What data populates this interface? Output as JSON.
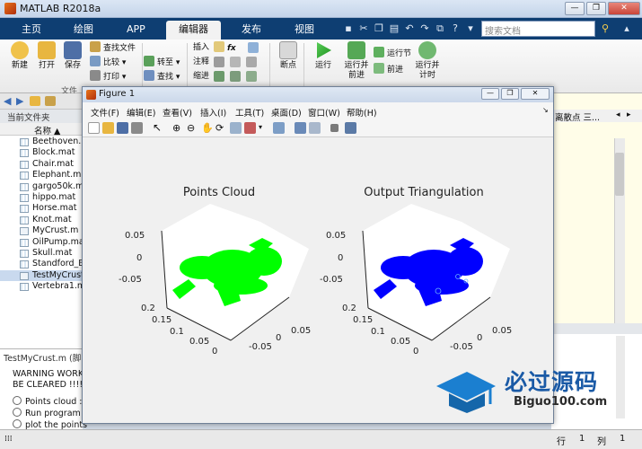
{
  "app": {
    "title": "MATLAB R2018a"
  },
  "tabs": [
    "主页",
    "绘图",
    "APP",
    "编辑器",
    "发布",
    "视图"
  ],
  "active_tab": "编辑器",
  "search": {
    "placeholder": "搜索文档"
  },
  "ribbon": {
    "big_buttons": [
      "新建",
      "打开",
      "保存",
      "断点",
      "运行",
      "运行并前进",
      "运行节",
      "前进",
      "运行并计时"
    ],
    "find_files": "查找文件",
    "compare": "比较",
    "print": "打印",
    "insert": "插入",
    "comment": "注释",
    "indent": "缩进",
    "goto": "转至",
    "find": "查找",
    "fx": "fx",
    "group_file": "文件",
    "run_and_advance": "运行并前进",
    "run_section": "运行节",
    "advance": "前进",
    "run_and_time": "运行并计时"
  },
  "path_right": "matlab",
  "right_panel_header": "离散点 三...",
  "left_panel": {
    "title": "当前文件夹",
    "column_name": "名称 ▲",
    "files": [
      "Beethoven.mat",
      "Block.mat",
      "Chair.mat",
      "Elephant.mat",
      "gargo50k.mat",
      "hippo.mat",
      "Horse.mat",
      "Knot.mat",
      "MyCrust.m",
      "OilPump.mat",
      "Skull.mat",
      "Standford_Bu",
      "TestMyCrust.m",
      "Vertebra1.mat"
    ],
    "selected": "TestMyCrust.m",
    "details_title": "TestMyCrust.m (脚",
    "details_lines": [
      "WARNING WORK",
      "BE CLEARED !!!!!",
      "Points cloud :",
      "Run  program",
      "plot the points"
    ]
  },
  "figure": {
    "title": "Figure 1",
    "menus": [
      "文件(F)",
      "编辑(E)",
      "查看(V)",
      "插入(I)",
      "工具(T)",
      "桌面(D)",
      "窗口(W)",
      "帮助(H)"
    ],
    "left_title": "Points Cloud",
    "right_title": "Output Triangulation",
    "left_color": "#00ff00",
    "right_color": "#0000ff",
    "z_ticks": [
      "0.05",
      "0",
      "-0.05"
    ],
    "y_ticks": [
      "0.2",
      "0.15",
      "0.1",
      "0.05",
      "0"
    ],
    "x_ticks": [
      "0.05",
      "0",
      "-0.05"
    ]
  },
  "status": {
    "row_label": "行",
    "row_value": "1",
    "col_label": "列",
    "col_value": "1"
  },
  "watermark": {
    "text_cn": "必过源码",
    "text_en": "Biguo100.com"
  }
}
